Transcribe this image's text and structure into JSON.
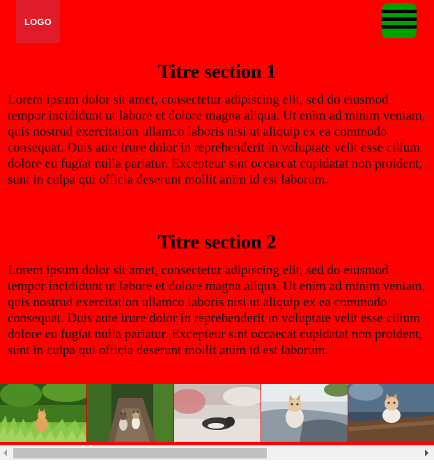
{
  "header": {
    "logo_label": "LOGO",
    "menu_icon": "hamburger-menu-icon"
  },
  "sections": [
    {
      "title": "Titre section 1",
      "body": "Lorem ipsum dolor sit amet, consectetur adipiscing elit, sed do eiusmod tempor incididunt ut labore et dolore magna aliqua. Ut enim ad minim veniam, quis nostrud exercitation ullamco laboris nisi ut aliquip ex ea commodo consequat. Duis aute irure dolor in reprehenderit in voluptate velit esse cillum dolore eu fugiat nulla pariatur. Excepteur sint occaecat cupidatat non proident, sunt in culpa qui officia deserunt mollit anim id est laborum."
    },
    {
      "title": "Titre section 2",
      "body": "Lorem ipsum dolor sit amet, consectetur adipiscing elit, sed do eiusmod tempor incididunt ut labore et dolore magna aliqua. Ut enim ad minim veniam, quis nostrud exercitation ullamco laboris nisi ut aliquip ex ea commodo consequat. Duis aute irure dolor in reprehenderit in voluptate velit esse cillum dolore eu fugiat nulla pariatur. Excepteur sint occaecat cupidatat non proident, sunt in culpa qui officia deserunt mollit anim id est laborum."
    }
  ],
  "gallery": {
    "images": [
      "kitten-in-grass-photo",
      "two-kittens-on-path-photo",
      "cat-sleeping-on-bed-photo",
      "kitten-on-sofa-photo",
      "kitten-on-table-photo"
    ]
  },
  "colors": {
    "page_background": "#ff0000",
    "logo_background": "#e01b2a",
    "menu_button": "#00a000"
  }
}
